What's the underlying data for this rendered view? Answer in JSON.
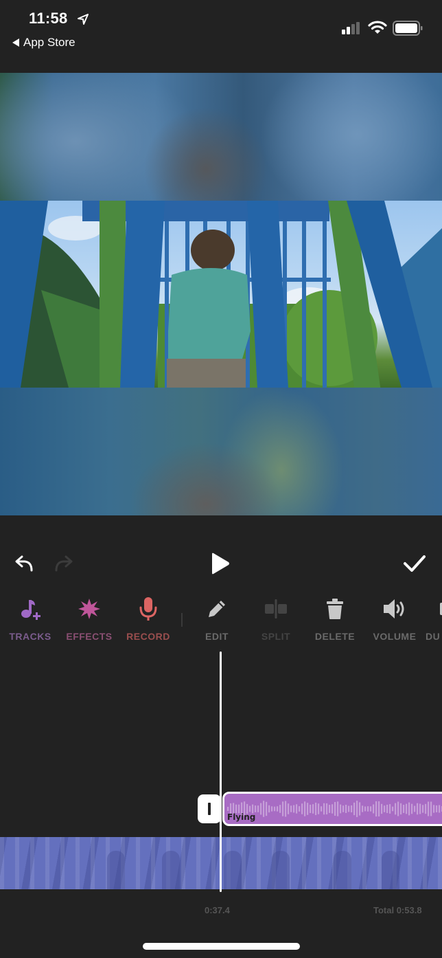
{
  "status_bar": {
    "time": "11:58",
    "back_label": "App Store",
    "icons": [
      "location-arrow-icon",
      "cellular-signal-icon",
      "wifi-icon",
      "battery-icon"
    ]
  },
  "preview": {
    "description": "Video frame: child in teal shirt on blue and green playground structure, blurred fill above and below"
  },
  "controls": {
    "undo": "undo-icon",
    "redo": "redo-icon",
    "play": "play-icon",
    "done": "checkmark-icon"
  },
  "tools": [
    {
      "label": "TRACKS",
      "icon": "music-note-plus-icon",
      "color": "#a069c6",
      "label_color": "#7b5c8d",
      "enabled": true
    },
    {
      "label": "EFFECTS",
      "icon": "starburst-icon",
      "color": "#c0569a",
      "label_color": "#8a4f72",
      "enabled": true
    },
    {
      "label": "RECORD",
      "icon": "microphone-icon",
      "color": "#dc6563",
      "label_color": "#9a4e4e",
      "enabled": true
    },
    {
      "label": "EDIT",
      "icon": "pencil-icon",
      "color": "#c8c8c8",
      "label_color": "#6a6a6a",
      "enabled": true
    },
    {
      "label": "SPLIT",
      "icon": "split-icon",
      "color": "#444444",
      "label_color": "#444444",
      "enabled": false
    },
    {
      "label": "DELETE",
      "icon": "trash-icon",
      "color": "#c8c8c8",
      "label_color": "#6a6a6a",
      "enabled": true
    },
    {
      "label": "VOLUME",
      "icon": "speaker-icon",
      "color": "#c8c8c8",
      "label_color": "#6a6a6a",
      "enabled": true
    },
    {
      "label": "DU",
      "icon": "duplicate-icon",
      "color": "#c8c8c8",
      "label_color": "#6a6a6a",
      "enabled": true
    }
  ],
  "timeline": {
    "audio_clip_name": "Flying",
    "audio_clip_color": "#a86cc4",
    "video_track_color": "#6470be",
    "current_time": "0:37.4",
    "total_time": "Total 0:53.8"
  }
}
